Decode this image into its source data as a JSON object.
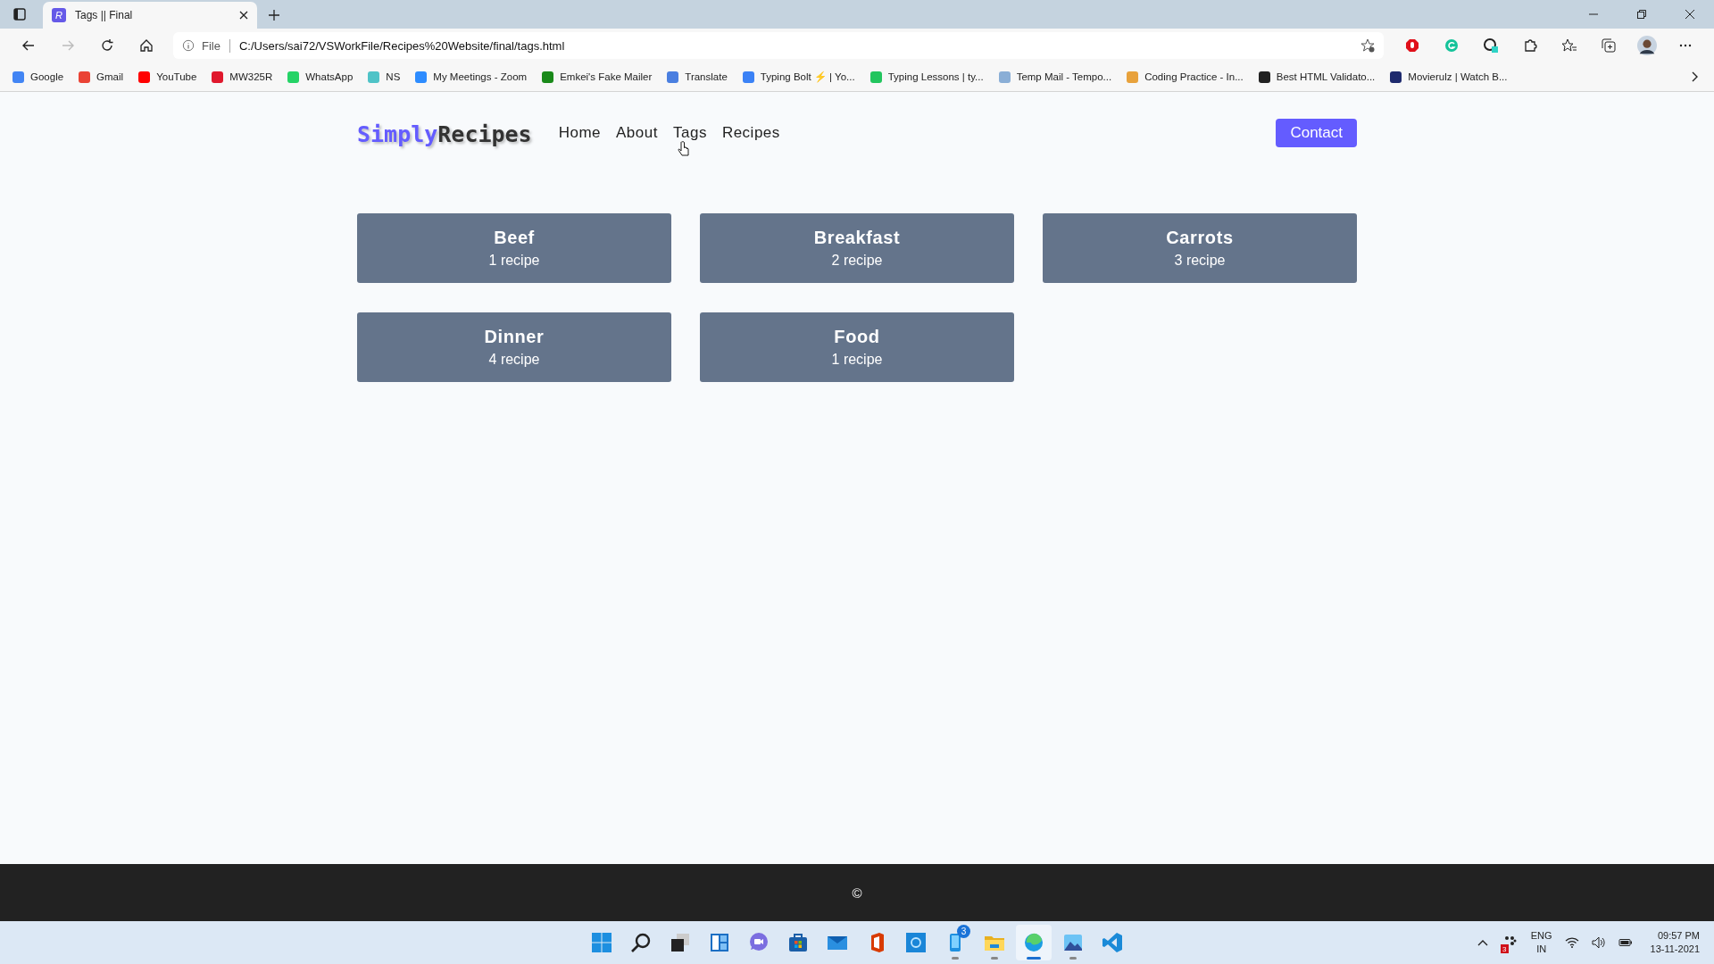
{
  "browser": {
    "tab": {
      "title": "Tags || Final",
      "favicon": "R"
    },
    "address": {
      "scheme": "File",
      "url": "C:/Users/sai72/VSWorkFile/Recipes%20Website/final/tags.html"
    },
    "bookmarks": [
      {
        "label": "Google",
        "color": "#4285f4"
      },
      {
        "label": "Gmail",
        "color": "#ea4335"
      },
      {
        "label": "YouTube",
        "color": "#ff0000"
      },
      {
        "label": "MW325R",
        "color": "#e0182d"
      },
      {
        "label": "WhatsApp",
        "color": "#25d366"
      },
      {
        "label": "NS",
        "color": "#4fc3c7"
      },
      {
        "label": "My Meetings - Zoom",
        "color": "#2d8cff"
      },
      {
        "label": "Emkei's Fake Mailer",
        "color": "#1a8a1a"
      },
      {
        "label": "Translate",
        "color": "#4a7fe0"
      },
      {
        "label": "Typing Bolt ⚡ | Yo...",
        "color": "#3b82f6"
      },
      {
        "label": "Typing Lessons | ty...",
        "color": "#22c55e"
      },
      {
        "label": "Temp Mail - Tempo...",
        "color": "#8aaed6"
      },
      {
        "label": "Coding Practice - In...",
        "color": "#e8a23c"
      },
      {
        "label": "Best HTML Validato...",
        "color": "#222222"
      },
      {
        "label": "Movierulz | Watch B...",
        "color": "#1e2a6e"
      }
    ]
  },
  "page": {
    "logo": {
      "first": "Simply",
      "second": "Recipes"
    },
    "nav": [
      "Home",
      "About",
      "Tags",
      "Recipes"
    ],
    "contact": "Contact",
    "tags": [
      {
        "name": "Beef",
        "count": "1 recipe"
      },
      {
        "name": "Breakfast",
        "count": "2 recipe"
      },
      {
        "name": "Carrots",
        "count": "3 recipe"
      },
      {
        "name": "Dinner",
        "count": "4 recipe"
      },
      {
        "name": "Food",
        "count": "1 recipe"
      }
    ],
    "footer": "©"
  },
  "taskbar": {
    "apps": [
      {
        "kind": "start",
        "running": false,
        "active": false
      },
      {
        "kind": "search",
        "running": false,
        "active": false
      },
      {
        "kind": "taskview",
        "running": false,
        "active": false
      },
      {
        "kind": "widgets",
        "running": false,
        "active": false
      },
      {
        "kind": "chat",
        "running": false,
        "active": false
      },
      {
        "kind": "store",
        "running": false,
        "active": false
      },
      {
        "kind": "mail",
        "running": false,
        "active": false
      },
      {
        "kind": "office",
        "running": false,
        "active": false
      },
      {
        "kind": "cortana",
        "running": false,
        "active": false
      },
      {
        "kind": "phone",
        "running": true,
        "active": false,
        "badge": "3"
      },
      {
        "kind": "explorer",
        "running": true,
        "active": false
      },
      {
        "kind": "edge",
        "running": true,
        "active": true
      },
      {
        "kind": "photos",
        "running": true,
        "active": false
      },
      {
        "kind": "vscode",
        "running": false,
        "active": false
      }
    ],
    "tray": {
      "app_badge": "3",
      "language": "ENG",
      "region": "IN",
      "time": "09:57 PM",
      "date": "13-11-2021"
    }
  }
}
